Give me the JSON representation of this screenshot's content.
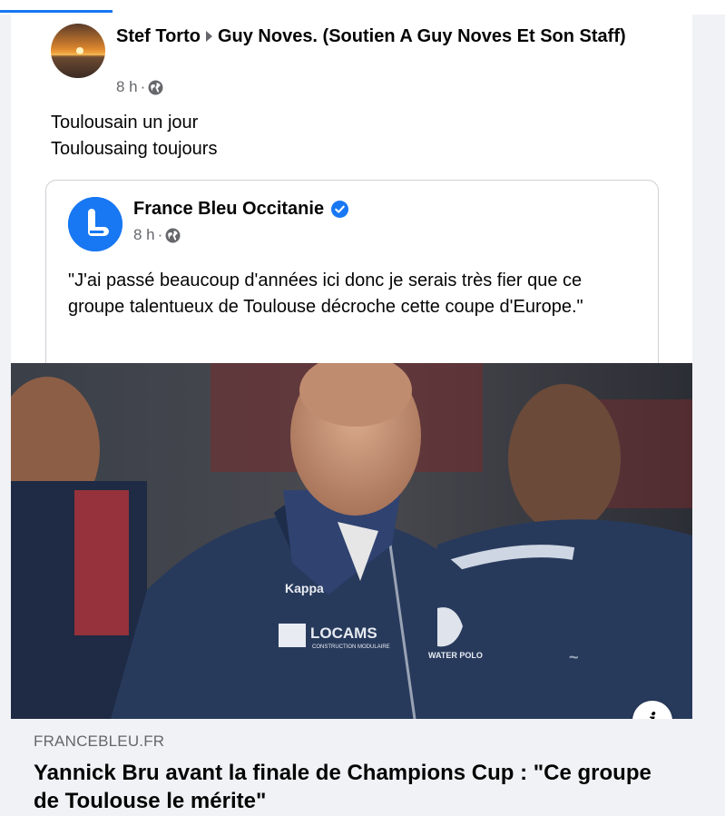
{
  "post": {
    "author": "Stef Torto",
    "group": "Guy Noves. (Soutien A Guy Noves Et Son Staff)",
    "time": "8 h",
    "dot": "·",
    "text_line1": "Toulousain un jour",
    "text_line2": "Toulousaing toujours"
  },
  "shared": {
    "page_name": "France Bleu Occitanie",
    "time": "8 h",
    "dot": "·",
    "text": "\"J'ai passé beaucoup d'années ici donc je serais très fier que ce groupe talentueux de Toulouse décroche cette coupe d'Europe.\""
  },
  "link": {
    "domain": "FRANCEBLEU.FR",
    "headline": "Yannick Bru avant la finale de Champions Cup : \"Ce groupe de Toulouse le mérite\"",
    "info_label": "i"
  },
  "jacket_texts": {
    "brand": "Kappa",
    "sponsor": "LOCAMS",
    "sponsor_sub": "CONSTRUCTION MODULAIRE",
    "crest": "WATER POLO"
  },
  "colors": {
    "accent": "#1877f2",
    "secondary_text": "#65676b",
    "jacket": "#283a5c"
  },
  "icons": {
    "globe": "globe-icon",
    "verified": "verified-badge-icon",
    "info": "info-icon",
    "arrow": "caret-right-icon"
  }
}
